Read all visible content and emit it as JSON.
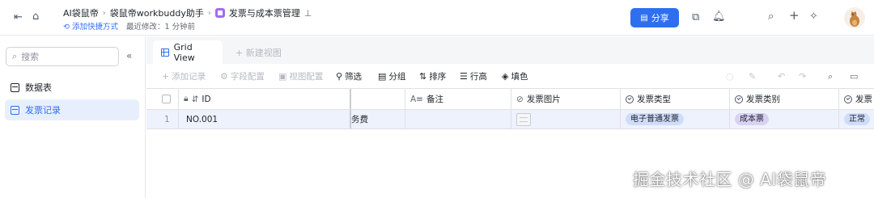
{
  "colors": {
    "accent": "#2e6ff0",
    "selected_row": "#eef2fd",
    "tag_blue": "#cfdcfa",
    "tag_purple": "#d9d2f3"
  },
  "header": {
    "breadcrumbs": [
      "AI袋鼠帝",
      "袋鼠帝workbuddy助手",
      "发票与成本票管理"
    ],
    "add_shortcut": "添加快捷方式",
    "last_modified": "最近修改：1 分钟前",
    "share_label": "分享"
  },
  "sidebar": {
    "search_placeholder": "搜索",
    "items": [
      {
        "label": "数据表",
        "active": false
      },
      {
        "label": "发票记录",
        "active": true
      }
    ]
  },
  "tabs": [
    {
      "label": "Grid View",
      "active": true
    },
    {
      "label": "+ 新建视图",
      "active": false
    }
  ],
  "toolbar": {
    "add_record": "+ 添加记录",
    "field_config": "字段配置",
    "view_config": "视图配置",
    "filter": "筛选",
    "group": "分组",
    "sort": "排序",
    "row_height": "行高",
    "fill": "填色"
  },
  "table": {
    "columns": [
      "ID",
      "",
      "备注",
      "发票图片",
      "发票类型",
      "发票类别",
      "发票"
    ],
    "rows": [
      {
        "num": "1",
        "id": "NO.001",
        "partial": "务费",
        "remark": "",
        "invoice_type": "电子普通发票",
        "invoice_category": "成本票",
        "status": "正常"
      }
    ]
  },
  "watermark": "掘金技术社区 @ AI袋鼠帝"
}
